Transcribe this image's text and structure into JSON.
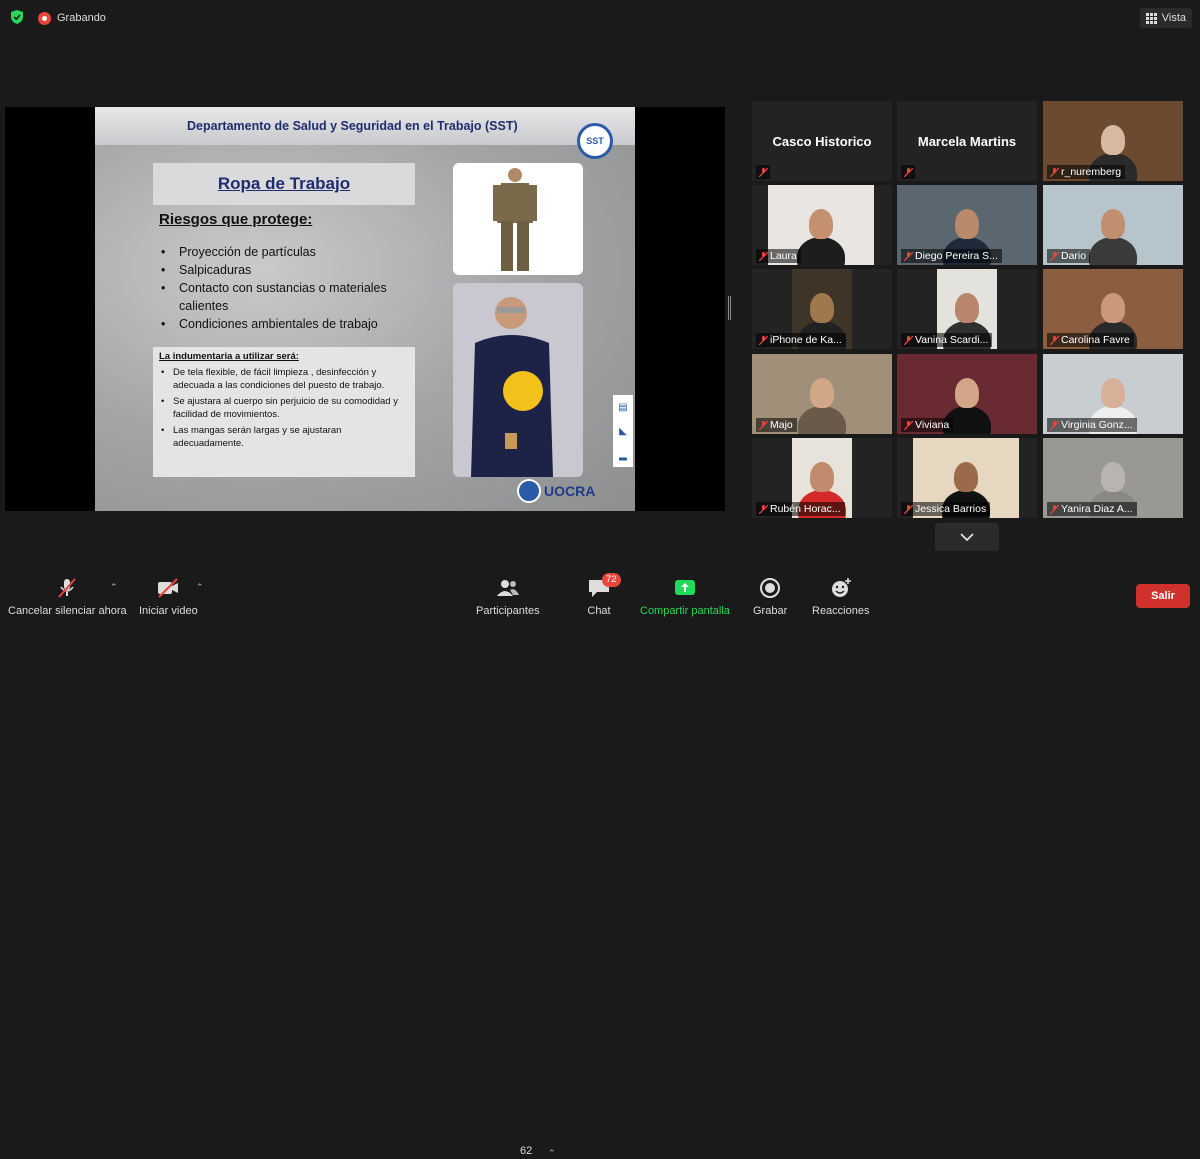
{
  "topbar": {
    "recording_label": "Grabando",
    "view_label": "Vista"
  },
  "slide": {
    "header_title": "Departamento de Salud y Seguridad en el Trabajo (SST)",
    "logo_text": "SST",
    "section_title": "Ropa de Trabajo",
    "risks_heading": "Riesgos que protege:",
    "risks": [
      "Proyección de partículas",
      "Salpicaduras",
      "Contacto con sustancias o materiales calientes",
      "Condiciones ambientales de trabajo"
    ],
    "clothing_heading": "La indumentaria a utilizar será:",
    "clothing_items": [
      "De tela flexible, de fácil limpieza , desinfección y adecuada a las condiciones del puesto de trabajo.",
      "Se ajustara al cuerpo sin perjuicio de su comodidad y facilidad de movimientos.",
      "Las mangas serán largas y se ajustaran adecuadamente."
    ],
    "org_logo": "UOCRA"
  },
  "participants": [
    {
      "name": "Casco Historico",
      "video": false
    },
    {
      "name": "Marcela Martins",
      "video": false
    },
    {
      "name": "r_nuremberg",
      "video": true
    },
    {
      "name": "Laura",
      "video": true
    },
    {
      "name": "Diego Pereira S...",
      "video": true,
      "active_speaker": true
    },
    {
      "name": "Dario",
      "video": true
    },
    {
      "name": "iPhone de Ka...",
      "video": true
    },
    {
      "name": "Vanina Scardi...",
      "video": true
    },
    {
      "name": "Carolina Favre",
      "video": true
    },
    {
      "name": "Majo",
      "video": true
    },
    {
      "name": "Viviana",
      "video": true
    },
    {
      "name": "Virginia Gonz...",
      "video": true
    },
    {
      "name": "Rubén Horac...",
      "video": true
    },
    {
      "name": "Jessica Barrios",
      "video": true
    },
    {
      "name": "Yanira Diaz A...",
      "video": true
    }
  ],
  "toolbar": {
    "unmute_label": "Cancelar silenciar ahora",
    "start_video_label": "Iniciar video",
    "participants_label": "Participantes",
    "participants_count": "62",
    "chat_label": "Chat",
    "chat_badge": "72",
    "share_label": "Compartir pantalla",
    "record_label": "Grabar",
    "reactions_label": "Reacciones",
    "leave_label": "Salir"
  },
  "colors": {
    "share_green": "#23d959",
    "leave_red": "#d0312d",
    "recording_red": "#e8453c",
    "active_speaker_border": "#d7e87a",
    "slide_title_blue": "#1f2d6e"
  }
}
